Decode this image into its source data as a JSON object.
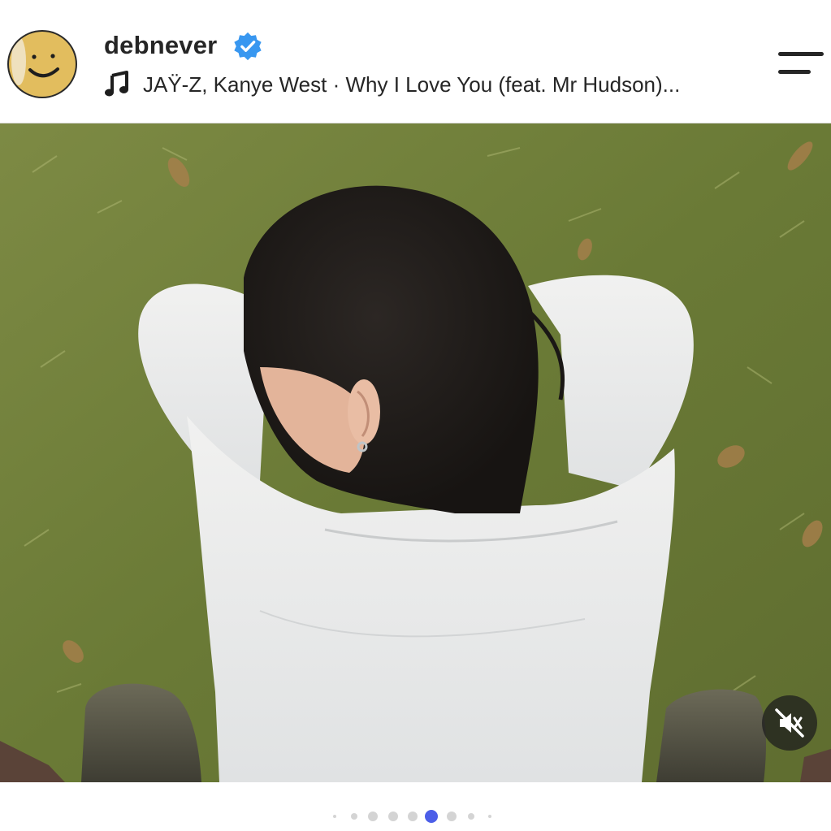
{
  "post": {
    "username": "debnever",
    "verified": true,
    "music": {
      "text": "JAŸ-Z, Kanye West · Why I Love You (feat. Mr Hudson)..."
    },
    "media": {
      "description_icon": "photo",
      "muted": true
    },
    "carousel": {
      "total_dots_visible": 9,
      "active_index": 5
    }
  },
  "icons": {
    "avatar": "smiley-face-avatar",
    "verified": "verified-badge-icon",
    "music": "music-note-icon",
    "menu": "menu-icon",
    "mute": "speaker-muted-icon"
  },
  "colors": {
    "verified_blue": "#3897f0",
    "active_dot": "#4c5ee8",
    "inactive_dot": "#d4d4d4",
    "avatar_fill": "#e2bd5e"
  }
}
